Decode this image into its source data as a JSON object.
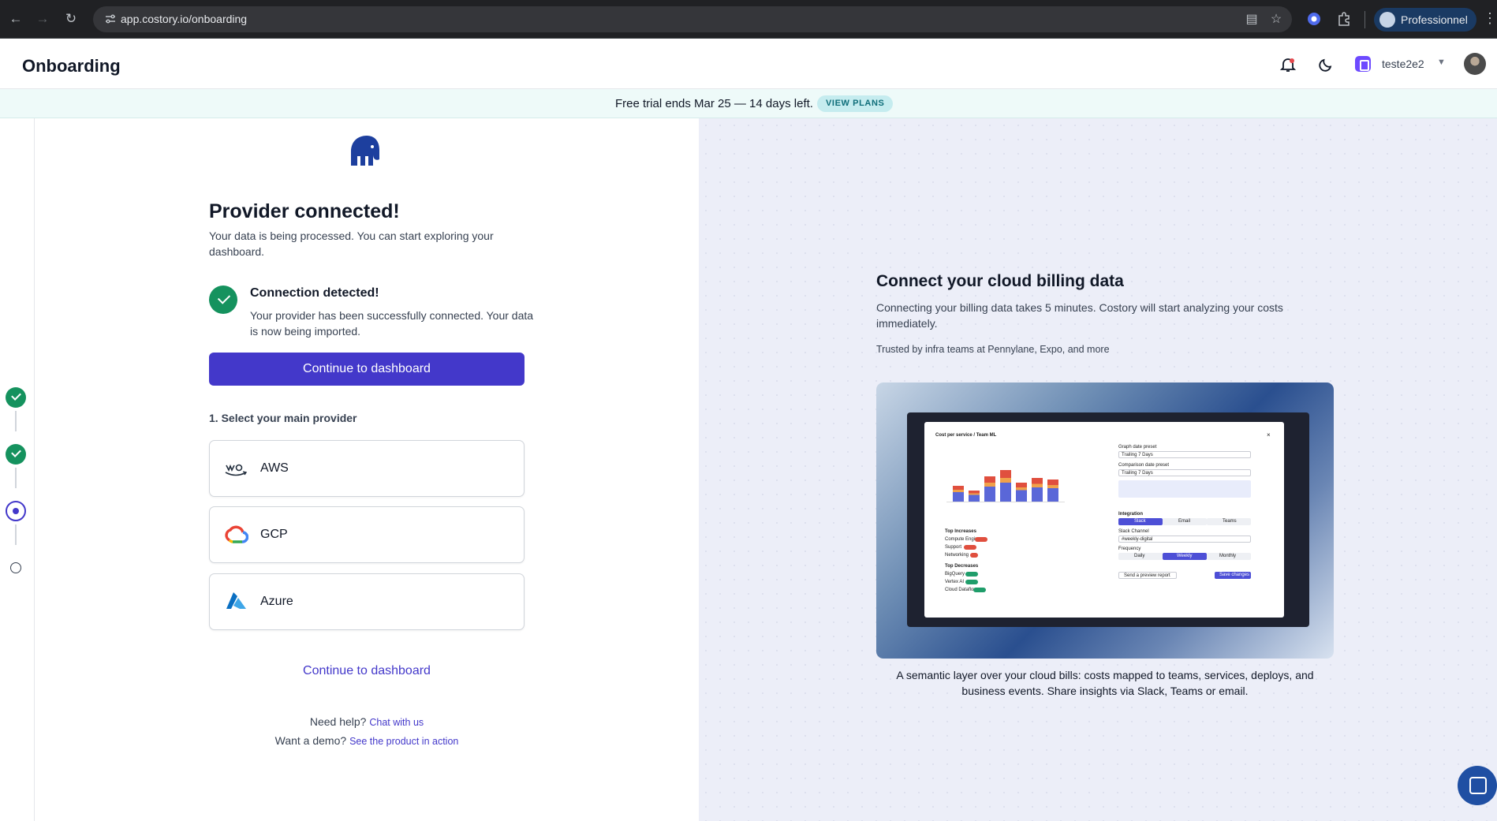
{
  "browser": {
    "url": "app.costory.io/onboarding",
    "profile_label": "Professionnel"
  },
  "header": {
    "title": "Onboarding",
    "workspace": "teste2e2"
  },
  "banner": {
    "text": "Free trial ends Mar 25 — 14 days left.",
    "cta": "VIEW PLANS"
  },
  "stepper": {
    "steps": [
      "done",
      "done",
      "active",
      "todo"
    ]
  },
  "main": {
    "title": "Provider connected!",
    "subtitle": "Your data is being processed. You can start exploring your dashboard.",
    "connection_title": "Connection detected!",
    "connection_desc": "Your provider has been successfully connected. Your data is now being imported.",
    "primary_button": "Continue to dashboard",
    "section_label": "1. Select your main provider",
    "providers": [
      {
        "name": "AWS",
        "icon": "aws-icon"
      },
      {
        "name": "GCP",
        "icon": "gcp-icon"
      },
      {
        "name": "Azure",
        "icon": "azure-icon"
      }
    ],
    "link_button": "Continue to dashboard",
    "help_text": "Need help?",
    "help_link": "Chat with us",
    "demo_text": "Want a demo?",
    "demo_link": "See the product in action"
  },
  "side": {
    "title": "Connect your cloud billing data",
    "subtitle": "Connecting your billing data takes 5 minutes. Costory will start analyzing your costs immediately.",
    "trusted": "Trusted by infra teams at Pennylane, Expo, and more",
    "caption": "A semantic layer over your cloud bills: costs mapped to teams, services, deploys, and business events. Share insights via Slack, Teams or email.",
    "preview": {
      "modal_title": "Cost per service / Team ML",
      "graph_preset_label": "Graph date preset",
      "graph_preset_value": "Trailing 7 Days",
      "comparison_label": "Comparison date preset",
      "comparison_value": "Trailing 7 Days",
      "integration_label": "Integration",
      "tabs": [
        "Slack",
        "Email",
        "Teams"
      ],
      "channel_label": "Slack Channel",
      "channel_value": "#weekly-digital",
      "frequency_label": "Frequency",
      "frequency_options": [
        "Daily",
        "Weekly",
        "Monthly"
      ],
      "preview_button": "Send a preview report",
      "save_button": "Save changes",
      "increases_label": "Top Increases",
      "decreases_label": "Top Decreases",
      "increases": [
        "Compute Engine",
        "Support",
        "Networking"
      ],
      "decreases": [
        "BigQuery",
        "Vertex AI",
        "Cloud Dataflow"
      ]
    }
  },
  "colors": {
    "primary": "#4338ca",
    "success": "#15925e",
    "banner_bg": "#eefaf9",
    "right_bg": "#eceef8"
  }
}
